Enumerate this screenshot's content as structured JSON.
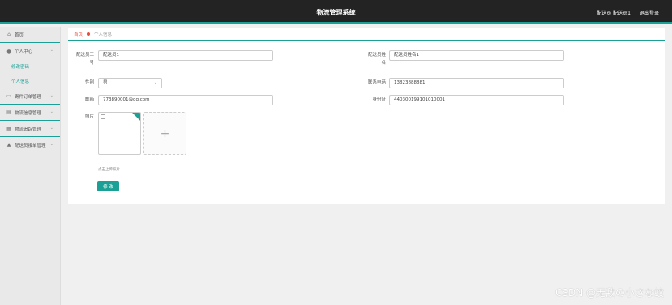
{
  "header": {
    "title": "物流管理系统",
    "user": "配送员 配送员1",
    "logout": "退出登录"
  },
  "sidebar": {
    "items": [
      {
        "label": "首页",
        "icon": "home-icon"
      },
      {
        "label": "个人中心",
        "icon": "user-icon",
        "sub": [
          "修改密码",
          "个人信息"
        ]
      },
      {
        "label": "寄件订单管理",
        "icon": "order-icon"
      },
      {
        "label": "物流信息管理",
        "icon": "list-icon"
      },
      {
        "label": "物流追踪管理",
        "icon": "track-icon"
      },
      {
        "label": "配送员接单管理",
        "icon": "courier-icon"
      }
    ]
  },
  "breadcrumb": {
    "home": "首页",
    "current": "个人信息"
  },
  "form": {
    "employee_no_label_1": "配送员工",
    "employee_no_label_2": "号",
    "employee_no": "配送员1",
    "name_label_1": "配送员姓",
    "name_label_2": "名",
    "name": "配送员姓名1",
    "gender_label": "性别",
    "gender": "男",
    "phone_label": "联系电话",
    "phone": "13823888881",
    "email_label": "邮箱",
    "email": "773890001@qq.com",
    "id_label": "身份证",
    "id_card": "440300199101010001",
    "photo_label": "照片",
    "upload_hint": "点击上传照片",
    "submit": "修 改"
  },
  "watermark": "CSDN @无敌の小さな蚊"
}
